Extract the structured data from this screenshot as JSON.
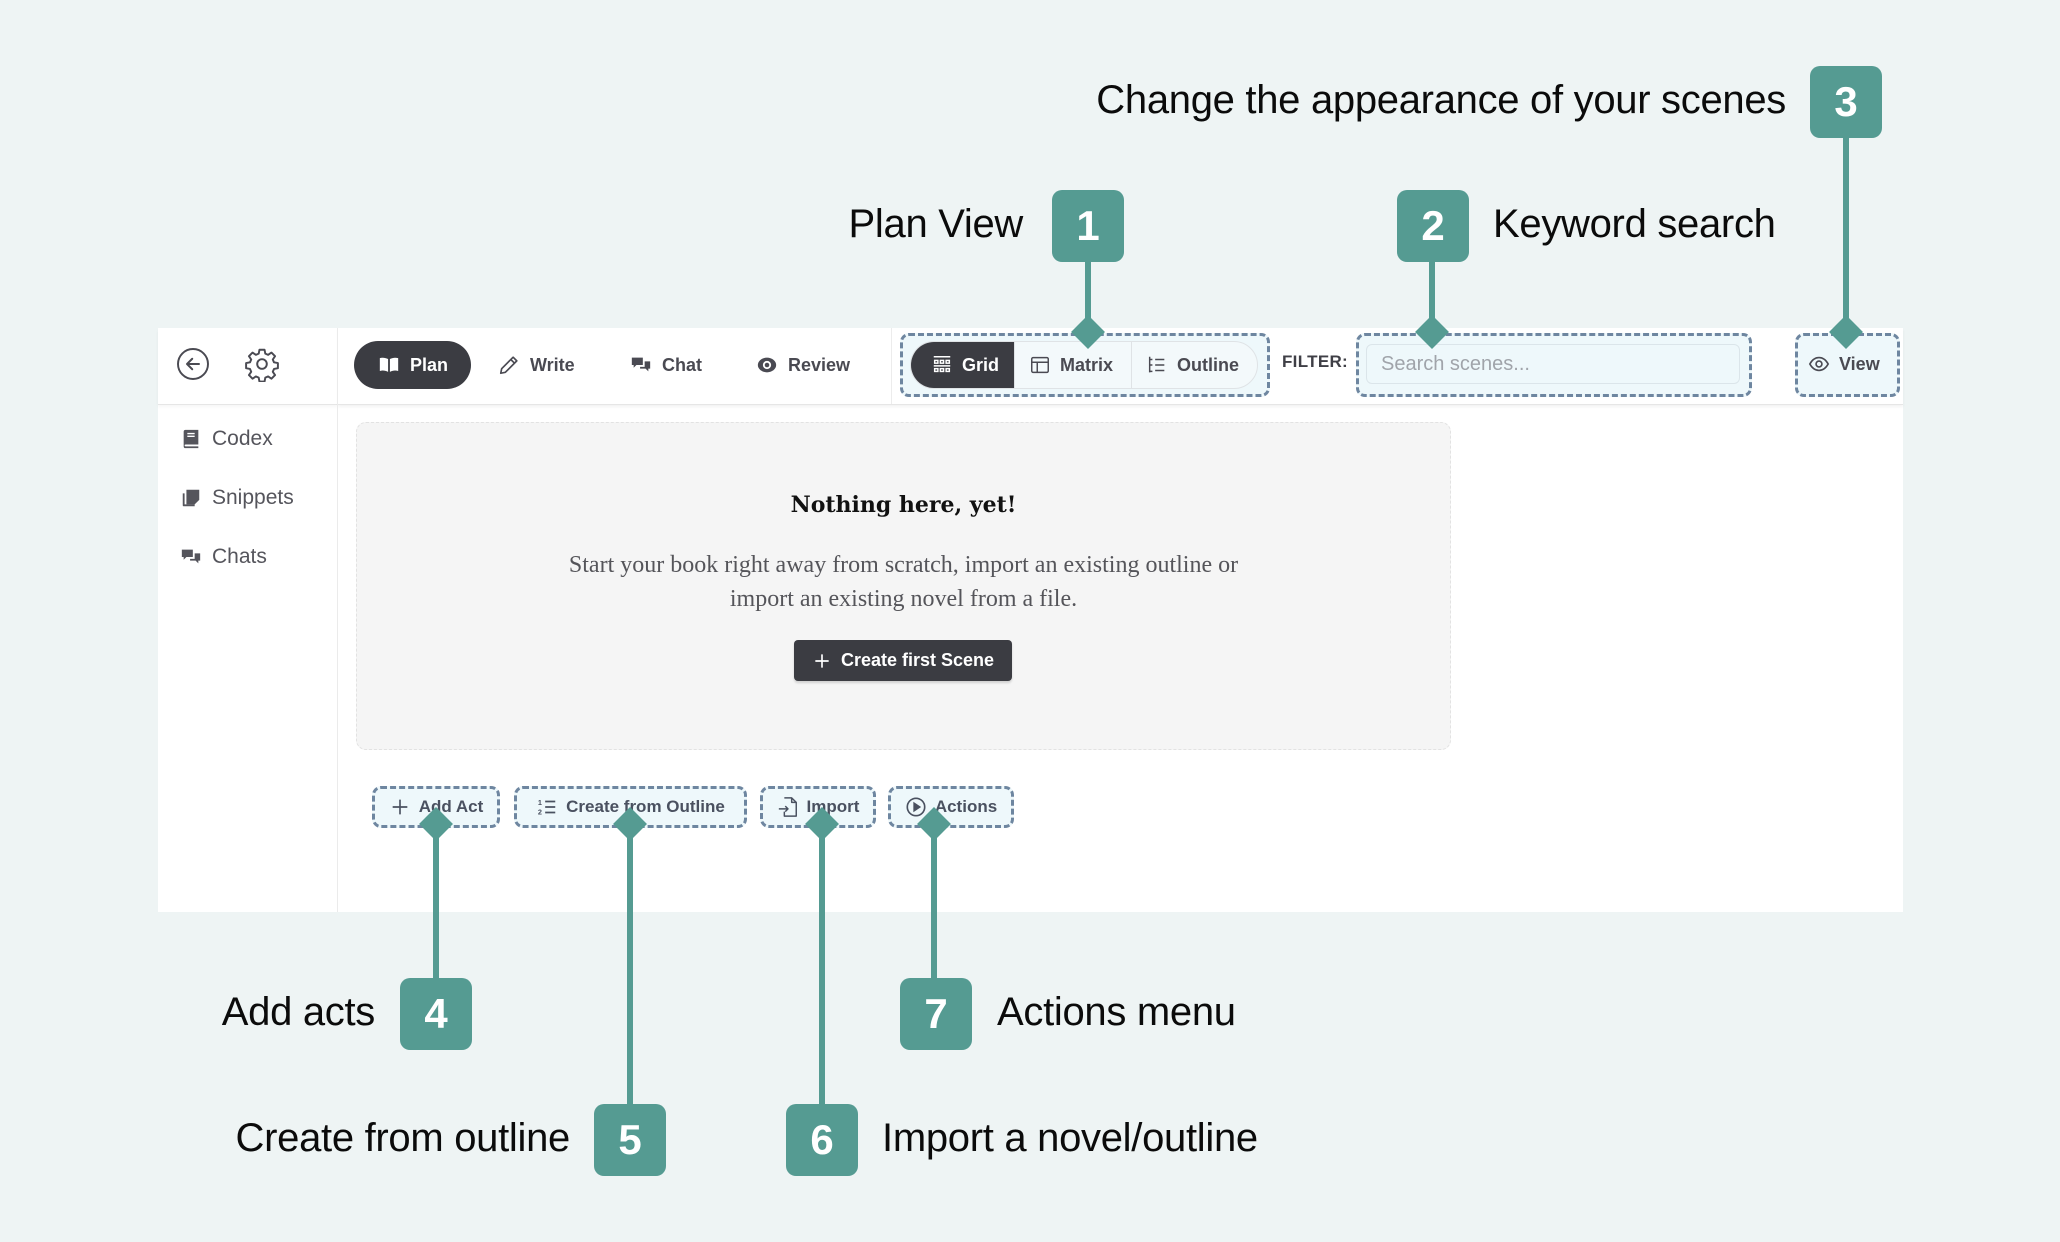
{
  "header": {
    "back_icon": "arrow-left-circle-icon",
    "settings_icon": "gear-icon",
    "tabs": [
      {
        "label": "Plan",
        "icon": "book-open-icon",
        "active": true
      },
      {
        "label": "Write",
        "icon": "pencil-icon",
        "active": false
      },
      {
        "label": "Chat",
        "icon": "chat-bubbles-icon",
        "active": false
      },
      {
        "label": "Review",
        "icon": "eye-icon",
        "active": false
      }
    ],
    "view_modes": [
      {
        "label": "Grid",
        "icon": "grid-icon",
        "active": true
      },
      {
        "label": "Matrix",
        "icon": "matrix-icon",
        "active": false
      },
      {
        "label": "Outline",
        "icon": "outline-icon",
        "active": false
      }
    ],
    "filter_label": "FILTER:",
    "search_placeholder": "Search scenes...",
    "search_value": "",
    "view_label": "View"
  },
  "sidebar": {
    "items": [
      {
        "label": "Codex",
        "icon": "book-icon"
      },
      {
        "label": "Snippets",
        "icon": "snippets-icon"
      },
      {
        "label": "Chats",
        "icon": "chat-bubbles-icon"
      }
    ]
  },
  "empty_state": {
    "title": "Nothing here, yet!",
    "text": "Start your book right away from scratch, import an existing outline or import an existing novel from a file.",
    "create_button": "Create first Scene"
  },
  "bottom_actions": [
    {
      "label": "Add Act",
      "icon": "plus-icon"
    },
    {
      "label": "Create from Outline",
      "icon": "numbered-list-icon"
    },
    {
      "label": "Import",
      "icon": "file-import-icon"
    },
    {
      "label": "Actions",
      "icon": "play-circle-icon"
    }
  ],
  "callouts": [
    {
      "number": "1",
      "text": "Plan View"
    },
    {
      "number": "2",
      "text": "Keyword search"
    },
    {
      "number": "3",
      "text": "Change  the appearance of your scenes"
    },
    {
      "number": "4",
      "text": "Add acts"
    },
    {
      "number": "5",
      "text": "Create from outline"
    },
    {
      "number": "6",
      "text": "Import a novel/outline"
    },
    {
      "number": "7",
      "text": "Actions menu"
    }
  ],
  "colors": {
    "callout_accent": "#559b92",
    "highlight_border": "#6e86a0",
    "active_dark": "#3b3c42",
    "background": "#eef4f4"
  }
}
